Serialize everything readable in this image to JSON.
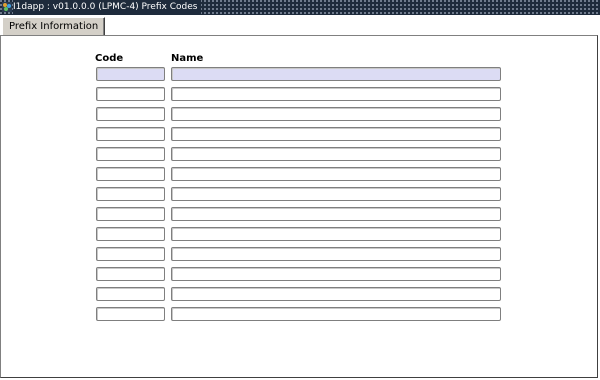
{
  "window": {
    "title": "I1dapp : v01.0.0.0 (LPMC-4) Prefix Codes"
  },
  "tabs": [
    {
      "label": "Prefix Information"
    }
  ],
  "table": {
    "columns": [
      "Code",
      "Name"
    ],
    "rows": [
      {
        "code": "",
        "name": ""
      },
      {
        "code": "",
        "name": ""
      },
      {
        "code": "",
        "name": ""
      },
      {
        "code": "",
        "name": ""
      },
      {
        "code": "",
        "name": ""
      },
      {
        "code": "",
        "name": ""
      },
      {
        "code": "",
        "name": ""
      },
      {
        "code": "",
        "name": ""
      },
      {
        "code": "",
        "name": ""
      },
      {
        "code": "",
        "name": ""
      },
      {
        "code": "",
        "name": ""
      },
      {
        "code": "",
        "name": ""
      },
      {
        "code": "",
        "name": ""
      }
    ],
    "active_row": 0
  },
  "colors": {
    "titlebar": "#1e2b3c",
    "active_field": "#dcdcf4",
    "field_border": "#7f7f7f"
  }
}
